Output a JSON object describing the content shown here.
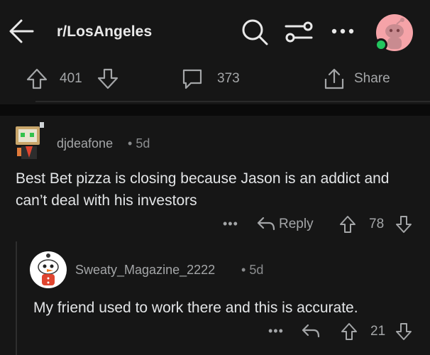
{
  "header": {
    "subreddit": "r/LosAngeles",
    "icons": [
      "back-arrow-icon",
      "search-icon",
      "filter-sliders-icon",
      "more-dots-icon"
    ]
  },
  "post_actions": {
    "upvotes": "401",
    "comments": "373",
    "share_label": "Share"
  },
  "comments": [
    {
      "author": "djdeafone",
      "age": "5d",
      "body": "Best Bet pizza is closing because Jason is an addict and can’t deal with his investors",
      "reply_label": "Reply",
      "votes": "78",
      "more": "•••"
    },
    {
      "author": "Sweaty_Magazine_2222",
      "age": "5d",
      "body": "My friend used to work there and this is accurate.",
      "votes": "21",
      "more": "•••"
    }
  ],
  "colors": {
    "background": "#161616",
    "text": "#e3e5e7",
    "muted": "#a4a6a8",
    "online": "#22c55e",
    "user_avatar_bg": "#f5a3a8"
  }
}
